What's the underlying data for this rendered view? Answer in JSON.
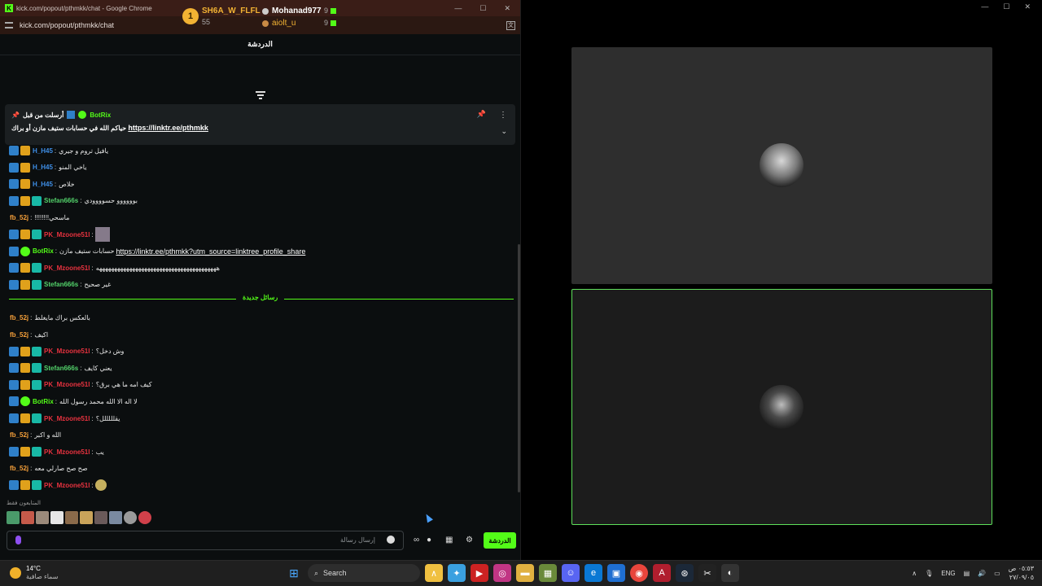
{
  "window": {
    "title": "kick.com/popout/pthmkk/chat - Google Chrome",
    "url": "kick.com/popout/pthmkk/chat"
  },
  "chat": {
    "header": "الدردشة",
    "top_gifters": [
      {
        "rank": "1",
        "name": "SH6A_W_FLFL",
        "count": "55"
      },
      {
        "name": "Mohanad977",
        "count": "9"
      },
      {
        "name": "aiolt_u",
        "count": "9"
      }
    ],
    "pinned": {
      "sent_by_label": "أرسلت من قبل",
      "author": "BotRix",
      "message": "حياكم الله في حسابات ستيف مازن أو براك",
      "link": "https://linktr.ee/pthmkk"
    },
    "new_messages_label": "رسائل جديدة",
    "messages": [
      {
        "user": "H_H45",
        "color": "#3e8ee6",
        "text": "يافيل تروم و جيري",
        "badges": [
          "arrow",
          "crown"
        ]
      },
      {
        "user": "H_H45",
        "color": "#3e8ee6",
        "text": "ياخي المنو",
        "badges": [
          "arrow",
          "crown"
        ]
      },
      {
        "user": "H_H45",
        "color": "#3e8ee6",
        "text": "خلاص",
        "badges": [
          "arrow",
          "crown"
        ]
      },
      {
        "user": "Stefan666s",
        "color": "#53d36b",
        "text": "بوووووو حسوووودي",
        "badges": [
          "arrow",
          "crown",
          "sub"
        ]
      },
      {
        "user": "fb_52j",
        "color": "#f6a03a",
        "text": "!!!!!!!!ماسحي",
        "badges": []
      },
      {
        "user": "PK_Mzoone51l",
        "color": "#e8323f",
        "text": "",
        "badges": [
          "arrow",
          "crown",
          "sub"
        ],
        "emote": true
      },
      {
        "user": "BotRix",
        "color": "#53fc18",
        "text": "حسابات ستيف مازن",
        "link": "https://linktr.ee/pthmkk?utm_source=linktree_profile_share",
        "badges": [
          "arrow",
          "ver"
        ]
      },
      {
        "user": "PK_Mzoone51l",
        "color": "#e8323f",
        "text": "ههههههههههههههههههههههههههههههههههههههههه",
        "badges": [
          "arrow",
          "crown",
          "sub"
        ]
      },
      {
        "user": "Stefan666s",
        "color": "#53d36b",
        "text": "غير صحيح",
        "badges": [
          "arrow",
          "crown",
          "sub"
        ]
      },
      {
        "user": "fb_52j",
        "color": "#f6a03a",
        "text": "بالعكس براك مايغلط",
        "badges": []
      },
      {
        "user": "fb_52j",
        "color": "#f6a03a",
        "text": "اكيف",
        "badges": []
      },
      {
        "user": "PK_Mzoone51l",
        "color": "#e8323f",
        "text": "وش دخل؟",
        "badges": [
          "arrow",
          "crown",
          "sub"
        ]
      },
      {
        "user": "Stefan666s",
        "color": "#53d36b",
        "text": "يعني كايف",
        "badges": [
          "arrow",
          "crown",
          "sub"
        ]
      },
      {
        "user": "PK_Mzoone51l",
        "color": "#e8323f",
        "text": "كيف امه ما هي برق؟",
        "badges": [
          "arrow",
          "crown",
          "sub"
        ]
      },
      {
        "user": "BotRix",
        "color": "#53fc18",
        "text": "لا اله الا الله محمد رسول الله",
        "badges": [
          "arrow",
          "ver"
        ]
      },
      {
        "user": "PK_Mzoone51l",
        "color": "#e8323f",
        "text": "يقلللللل؟",
        "badges": [
          "arrow",
          "crown",
          "sub"
        ]
      },
      {
        "user": "fb_52j",
        "color": "#f6a03a",
        "text": "الله و اكبر",
        "badges": []
      },
      {
        "user": "PK_Mzoone51l",
        "color": "#e8323f",
        "text": "يب",
        "badges": [
          "arrow",
          "crown",
          "sub"
        ]
      },
      {
        "user": "fb_52j",
        "color": "#f6a03a",
        "text": "صح صح صارلي معه",
        "badges": []
      },
      {
        "user": "PK_Mzoone51l",
        "color": "#e8323f",
        "text": "",
        "badges": [
          "arrow",
          "crown",
          "sub"
        ],
        "emote_small": true
      }
    ],
    "followers_only_label": "المتابعون فقط",
    "input_placeholder": "إرسال رسالة",
    "send_button": "الدردشة"
  },
  "taskbar": {
    "temperature": "14°C",
    "weather_condition": "سماء صافية",
    "search_label": "Search",
    "language": "ENG",
    "time": "٠٥:٥٣ ص",
    "date": "٢٧/٠٩/٠٥"
  }
}
